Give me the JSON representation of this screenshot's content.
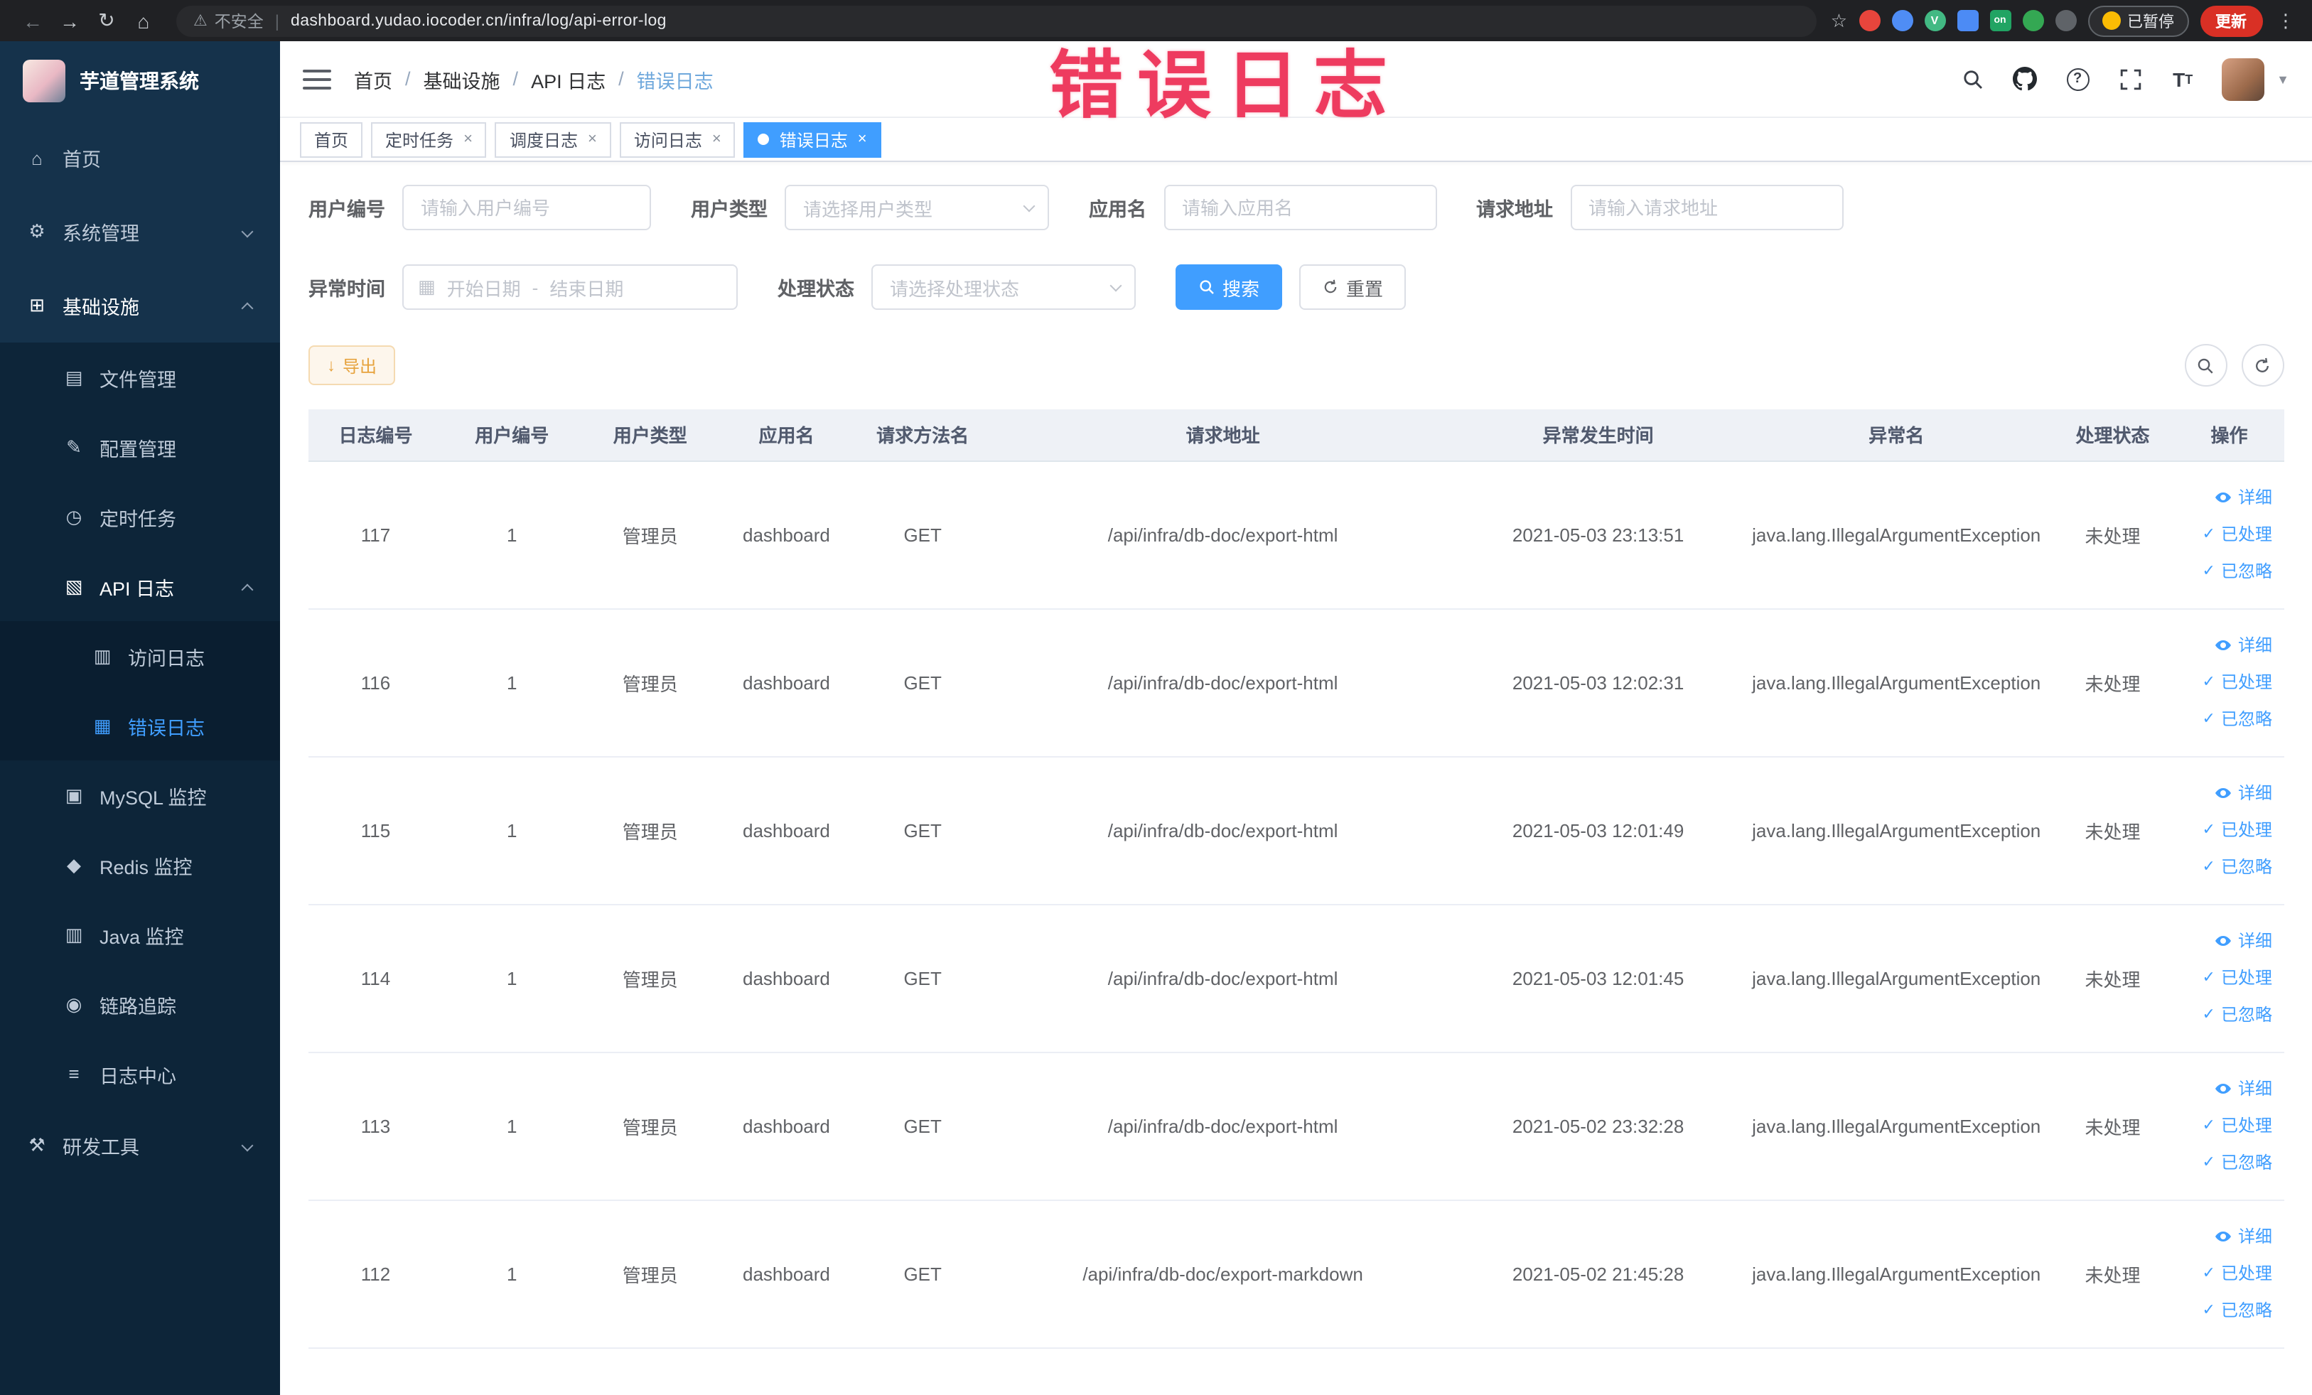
{
  "browser": {
    "security_label": "不安全",
    "url": "dashboard.yudao.iocoder.cn/infra/log/api-error-log",
    "paused_label": "已暂停",
    "update_label": "更新"
  },
  "annotation": {
    "text": "错误日志",
    "color": "#ee3b5f"
  },
  "sidebar": {
    "logo_title": "芋道管理系统",
    "items": [
      {
        "label": "首页",
        "icon": "home-icon"
      },
      {
        "label": "系统管理",
        "icon": "gear-icon"
      },
      {
        "label": "基础设施",
        "icon": "infra-icon"
      },
      {
        "label": "文件管理",
        "icon": "file-icon"
      },
      {
        "label": "配置管理",
        "icon": "config-icon"
      },
      {
        "label": "定时任务",
        "icon": "timer-icon"
      },
      {
        "label": "API 日志",
        "icon": "api-log-icon"
      },
      {
        "label": "访问日志",
        "icon": "access-log-icon"
      },
      {
        "label": "错误日志",
        "icon": "error-log-icon"
      },
      {
        "label": "MySQL 监控",
        "icon": "mysql-icon"
      },
      {
        "label": "Redis 监控",
        "icon": "redis-icon"
      },
      {
        "label": "Java 监控",
        "icon": "java-icon"
      },
      {
        "label": "链路追踪",
        "icon": "trace-icon"
      },
      {
        "label": "日志中心",
        "icon": "log-center-icon"
      },
      {
        "label": "研发工具",
        "icon": "devtools-icon"
      }
    ]
  },
  "navbar": {
    "breadcrumbs": [
      "首页",
      "基础设施",
      "API 日志",
      "错误日志"
    ]
  },
  "tabs": [
    {
      "label": "首页"
    },
    {
      "label": "定时任务"
    },
    {
      "label": "调度日志"
    },
    {
      "label": "访问日志"
    },
    {
      "label": "错误日志"
    }
  ],
  "filters": {
    "user_id": {
      "label": "用户编号",
      "placeholder": "请输入用户编号"
    },
    "user_type": {
      "label": "用户类型",
      "placeholder": "请选择用户类型"
    },
    "app_name": {
      "label": "应用名",
      "placeholder": "请输入应用名"
    },
    "request_url": {
      "label": "请求地址",
      "placeholder": "请输入请求地址"
    },
    "exception_time": {
      "label": "异常时间",
      "start_placeholder": "开始日期",
      "separator": "-",
      "end_placeholder": "结束日期"
    },
    "process_status": {
      "label": "处理状态",
      "placeholder": "请选择处理状态"
    },
    "search_label": "搜索",
    "reset_label": "重置"
  },
  "toolbar": {
    "export_label": "导出"
  },
  "table": {
    "columns": [
      "日志编号",
      "用户编号",
      "用户类型",
      "应用名",
      "请求方法名",
      "请求地址",
      "异常发生时间",
      "异常名",
      "处理状态",
      "操作"
    ],
    "actions": [
      "详细",
      "已处理",
      "已忽略"
    ],
    "rows": [
      {
        "id": "117",
        "user_id": "1",
        "user_type": "管理员",
        "app": "dashboard",
        "method": "GET",
        "url": "/api/infra/db-doc/export-html",
        "time": "2021-05-03 23:13:51",
        "exception": "java.lang.IllegalArgumentException",
        "status": "未处理"
      },
      {
        "id": "116",
        "user_id": "1",
        "user_type": "管理员",
        "app": "dashboard",
        "method": "GET",
        "url": "/api/infra/db-doc/export-html",
        "time": "2021-05-03 12:02:31",
        "exception": "java.lang.IllegalArgumentException",
        "status": "未处理"
      },
      {
        "id": "115",
        "user_id": "1",
        "user_type": "管理员",
        "app": "dashboard",
        "method": "GET",
        "url": "/api/infra/db-doc/export-html",
        "time": "2021-05-03 12:01:49",
        "exception": "java.lang.IllegalArgumentException",
        "status": "未处理"
      },
      {
        "id": "114",
        "user_id": "1",
        "user_type": "管理员",
        "app": "dashboard",
        "method": "GET",
        "url": "/api/infra/db-doc/export-html",
        "time": "2021-05-03 12:01:45",
        "exception": "java.lang.IllegalArgumentException",
        "status": "未处理"
      },
      {
        "id": "113",
        "user_id": "1",
        "user_type": "管理员",
        "app": "dashboard",
        "method": "GET",
        "url": "/api/infra/db-doc/export-html",
        "time": "2021-05-02 23:32:28",
        "exception": "java.lang.IllegalArgumentException",
        "status": "未处理"
      },
      {
        "id": "112",
        "user_id": "1",
        "user_type": "管理员",
        "app": "dashboard",
        "method": "GET",
        "url": "/api/infra/db-doc/export-markdown",
        "time": "2021-05-02 21:45:28",
        "exception": "java.lang.IllegalArgumentException",
        "status": "未处理"
      }
    ]
  }
}
